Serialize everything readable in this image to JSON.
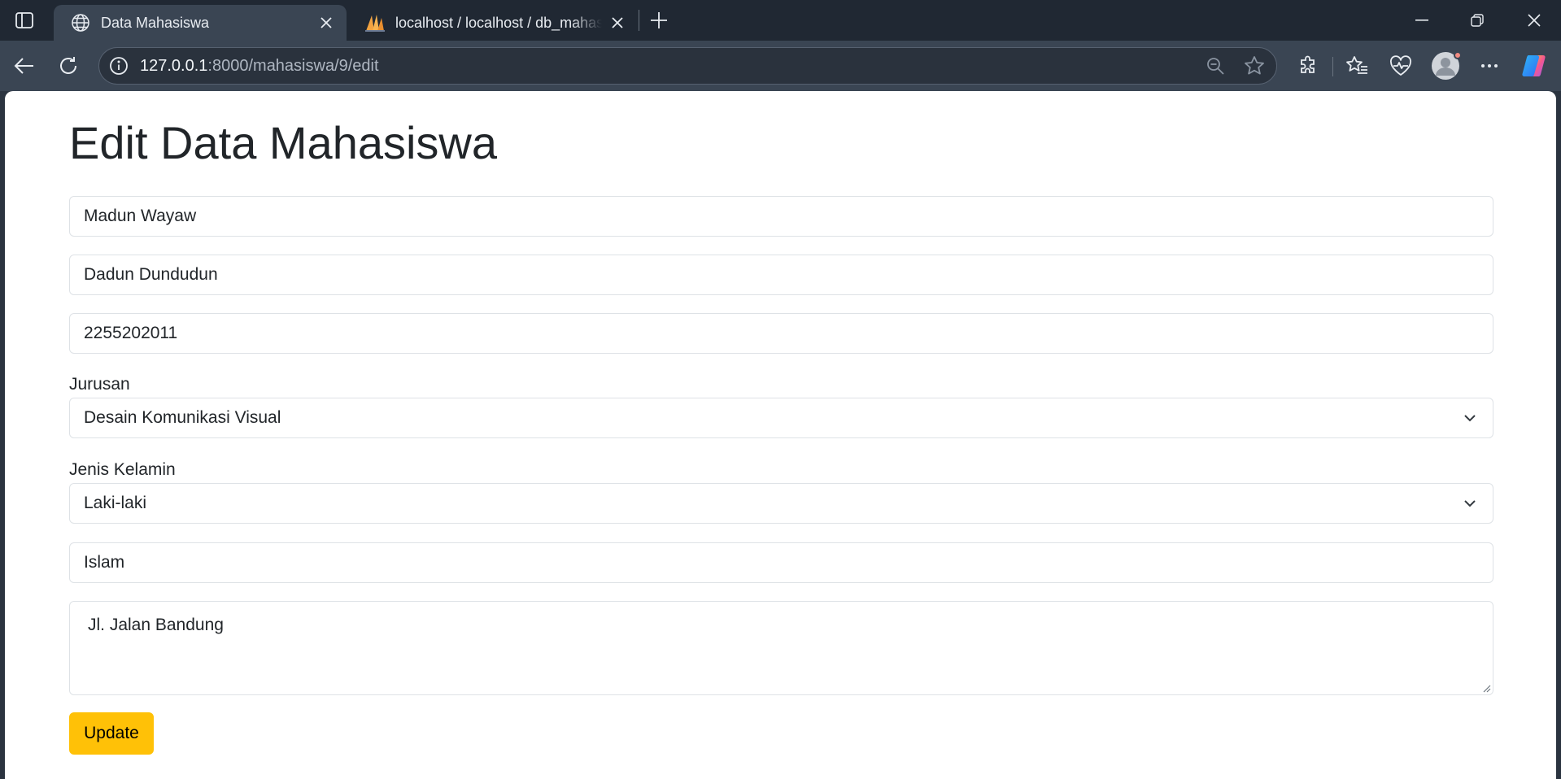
{
  "browser": {
    "tabs": [
      {
        "title": "Data Mahasiswa",
        "icon": "globe-icon",
        "active": true
      },
      {
        "title": "localhost / localhost / db_mahasiswa",
        "icon": "phpmyadmin-sail-icon",
        "active": false
      }
    ],
    "address": {
      "host": "127.0.0.1",
      "path": ":8000/mahasiswa/9/edit"
    },
    "colors": {
      "frame": "#202833",
      "toolbar": "#3a4553",
      "avatar_badge": "#f28b82"
    }
  },
  "page": {
    "title": "Edit Data Mahasiswa",
    "fields": {
      "nama": "Madun Wayaw",
      "nama_ortu": "Dadun Dundudun",
      "nim": "2255202011",
      "jurusan_label": "Jurusan",
      "jurusan_value": "Desain Komunikasi Visual",
      "jenis_kelamin_label": "Jenis Kelamin",
      "jenis_kelamin_value": "Laki-laki",
      "agama": "Islam",
      "alamat": "Jl. Jalan Bandung"
    },
    "submit_label": "Update",
    "colors": {
      "primary_button": "#ffc107",
      "text": "#212529",
      "border": "#dee2e6"
    }
  }
}
